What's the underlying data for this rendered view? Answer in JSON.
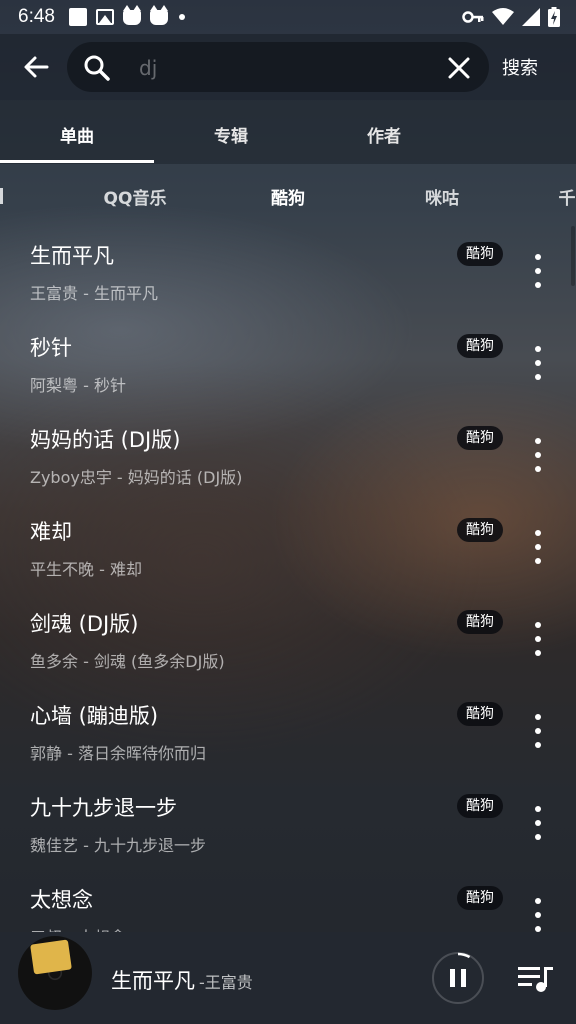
{
  "status_bar": {
    "time": "6:48"
  },
  "search": {
    "query": "dj",
    "placeholder": "dj",
    "submit_label": "搜索"
  },
  "primary_tabs": [
    {
      "label": "单曲",
      "active": true
    },
    {
      "label": "专辑",
      "active": false
    },
    {
      "label": "作者",
      "active": false
    }
  ],
  "source_tabs": [
    {
      "label": "QQ音乐",
      "active": false
    },
    {
      "label": "酷狗",
      "active": true
    },
    {
      "label": "咪咕",
      "active": false
    },
    {
      "label": "千",
      "active": false
    }
  ],
  "songs": [
    {
      "title": "生而平凡",
      "subtitle": "王富贵 - 生而平凡",
      "source": "酷狗"
    },
    {
      "title": "秒针",
      "subtitle": "阿梨粤 - 秒针",
      "source": "酷狗"
    },
    {
      "title": "妈妈的话 (DJ版)",
      "subtitle": "Zyboy忠宇 - 妈妈的话 (DJ版)",
      "source": "酷狗"
    },
    {
      "title": "难却",
      "subtitle": "平生不晚 - 难却",
      "source": "酷狗"
    },
    {
      "title": "剑魂 (DJ版)",
      "subtitle": "鱼多余 - 剑魂 (鱼多余DJ版)",
      "source": "酷狗"
    },
    {
      "title": "心墙 (蹦迪版)",
      "subtitle": "郭静 - 落日余晖待你而归",
      "source": "酷狗"
    },
    {
      "title": "九十九步退一步",
      "subtitle": "魏佳艺 - 九十九步退一步",
      "source": "酷狗"
    },
    {
      "title": "太想念",
      "subtitle": "三叔 - 太想念",
      "source": "酷狗"
    }
  ],
  "player": {
    "title": "生而平凡",
    "artist": "-王富贵",
    "progress": 0.08
  },
  "colors": {
    "active_indicator": "#ffffff",
    "badge_bg": "#0a0c10"
  }
}
